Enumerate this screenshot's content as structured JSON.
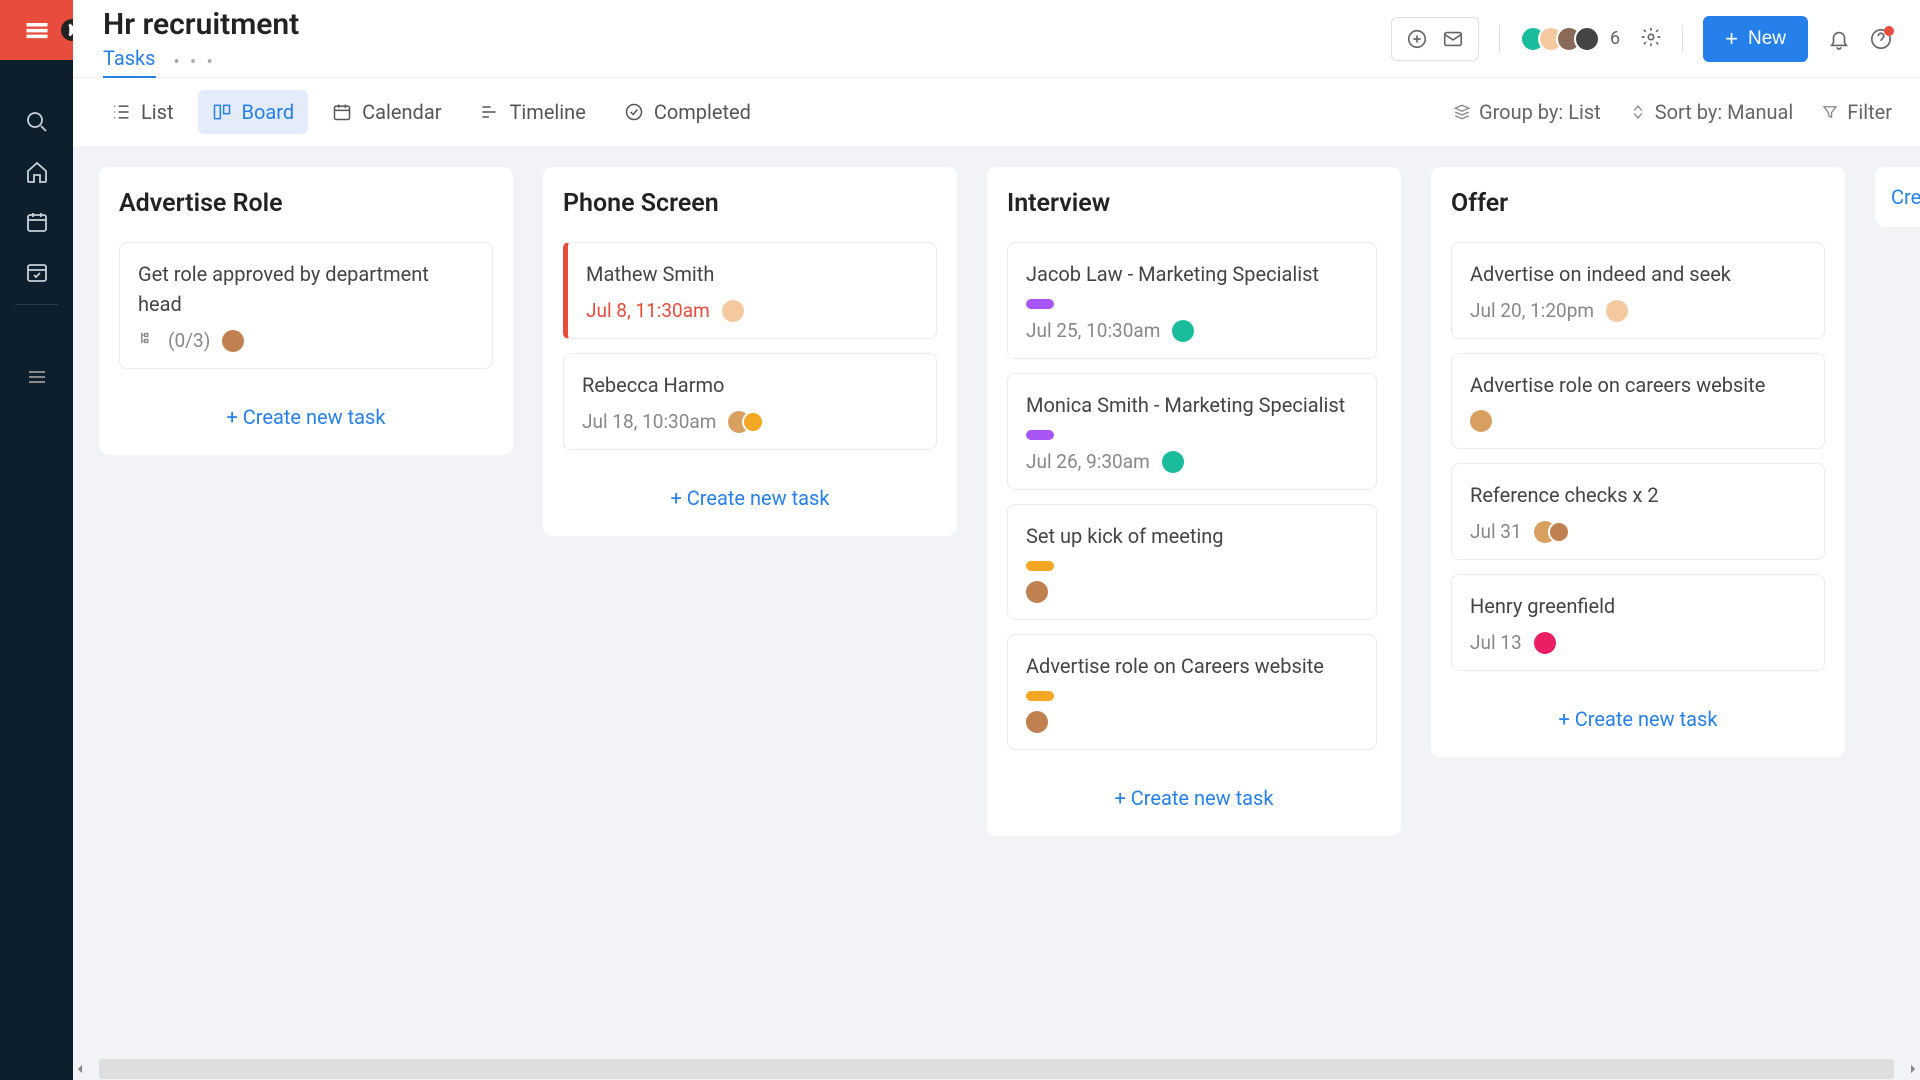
{
  "header": {
    "title": "Hr recruitment",
    "tab_tasks": "Tasks",
    "avatar_count": "6",
    "btn_new": "New"
  },
  "toolbar": {
    "views": {
      "list": "List",
      "board": "Board",
      "calendar": "Calendar",
      "timeline": "Timeline",
      "completed": "Completed"
    },
    "groupby": "Group by: List",
    "sortby": "Sort by: Manual",
    "filter": "Filter"
  },
  "columns": [
    {
      "title": "Advertise Role",
      "cards": [
        {
          "title": "Get role approved by department head",
          "subtask": "(0/3)",
          "avatar": "av-face3"
        }
      ],
      "create": "+ Create new task"
    },
    {
      "title": "Phone Screen",
      "cards": [
        {
          "title": "Mathew Smith",
          "date": "Jul 8, 11:30am",
          "overdue": true,
          "avatar": "av-face1"
        },
        {
          "title": "Rebecca Harmo",
          "date": "Jul 18, 10:30am",
          "avatar": "av-face2",
          "avatar2": "orange"
        }
      ],
      "create": "+ Create new task"
    },
    {
      "title": "Interview",
      "cards": [
        {
          "title": "Jacob Law - Marketing Specialist",
          "pill": "pill-purple",
          "date": "Jul 25, 10:30am",
          "avatar": "av-teal"
        },
        {
          "title": "Monica Smith - Marketing Specialist",
          "pill": "pill-purple",
          "date": "Jul 26, 9:30am",
          "avatar": "av-teal"
        },
        {
          "title": "Set up kick of meeting",
          "pill": "pill-orange",
          "avatar": "av-face3"
        },
        {
          "title": "Advertise role on Careers website",
          "pill": "pill-orange",
          "avatar": "av-face3"
        }
      ],
      "create": "+ Create new task"
    },
    {
      "title": "Offer",
      "cards": [
        {
          "title": "Advertise on indeed and seek",
          "date": "Jul 20, 1:20pm",
          "avatar": "av-face1"
        },
        {
          "title": "Advertise role on careers website",
          "avatar": "av-face2"
        },
        {
          "title": "Reference checks x 2",
          "date": "Jul 31",
          "avatar": "av-face2",
          "avatar2": true
        },
        {
          "title": "Henry greenfield",
          "date": "Jul 13",
          "avatar": "av-pink"
        }
      ],
      "create": "+ Create new task"
    }
  ],
  "create_column": "Create"
}
